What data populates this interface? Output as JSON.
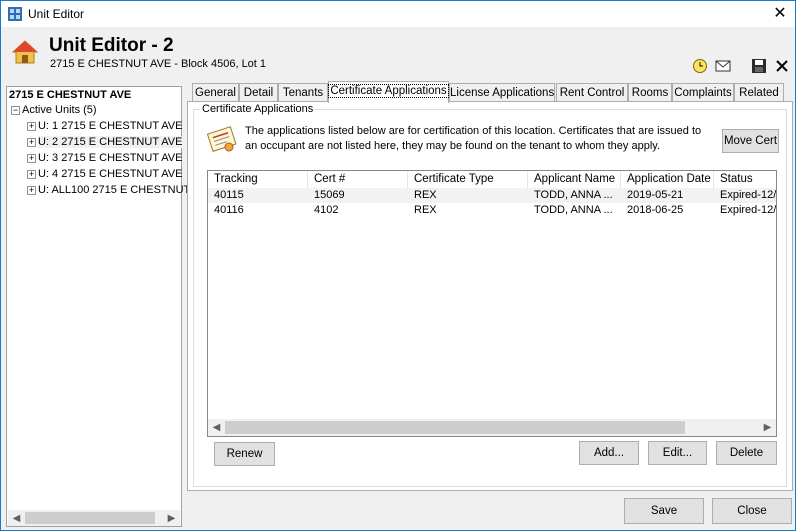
{
  "window": {
    "title": "Unit Editor",
    "close_glyph": "✕"
  },
  "header": {
    "title": "Unit Editor - 2",
    "subtitle": "2715 E CHESTNUT AVE - Block 4506, Lot 1",
    "icons": [
      "clock-icon",
      "mail-icon",
      "save-icon",
      "close-icon"
    ]
  },
  "tree": {
    "root": "2715 E CHESTNUT AVE",
    "group": "Active Units (5)",
    "items": [
      "U: 1 2715 E CHESTNUT AVE",
      "U: 2 2715 E CHESTNUT AVE",
      "U: 3 2715 E CHESTNUT AVE",
      "U: 4 2715 E CHESTNUT AVE",
      "U: ALL100 2715 E CHESTNUT"
    ]
  },
  "tabs": [
    "General",
    "Detail",
    "Tenants",
    "Certificate Applications",
    "License Applications",
    "Rent Control",
    "Rooms",
    "Complaints",
    "Related"
  ],
  "active_tab": "Certificate Applications",
  "panel": {
    "group_label": "Certificate Applications",
    "info_text": "The applications listed below are for certification of this location. Certificates that are issued to an occupant are not listed here, they may be found on the tenant to whom they apply.",
    "move_cert_label": "Move Cert"
  },
  "table": {
    "columns": [
      "Tracking",
      "Cert #",
      "Certificate Type",
      "Applicant Name",
      "Application Date",
      "Status"
    ],
    "rows": [
      [
        "40115",
        "15069",
        "REX",
        "TODD, ANNA ...",
        "2019-05-21",
        "Expired-12/"
      ],
      [
        "40116",
        "4102",
        "REX",
        "TODD, ANNA ...",
        "2018-06-25",
        "Expired-12/"
      ]
    ]
  },
  "buttons": {
    "renew": "Renew",
    "add": "Add...",
    "edit": "Edit...",
    "delete": "Delete",
    "save": "Save",
    "close": "Close"
  },
  "colors": {
    "accent": "#1979ca",
    "selected_row": "#e5f3ff"
  }
}
